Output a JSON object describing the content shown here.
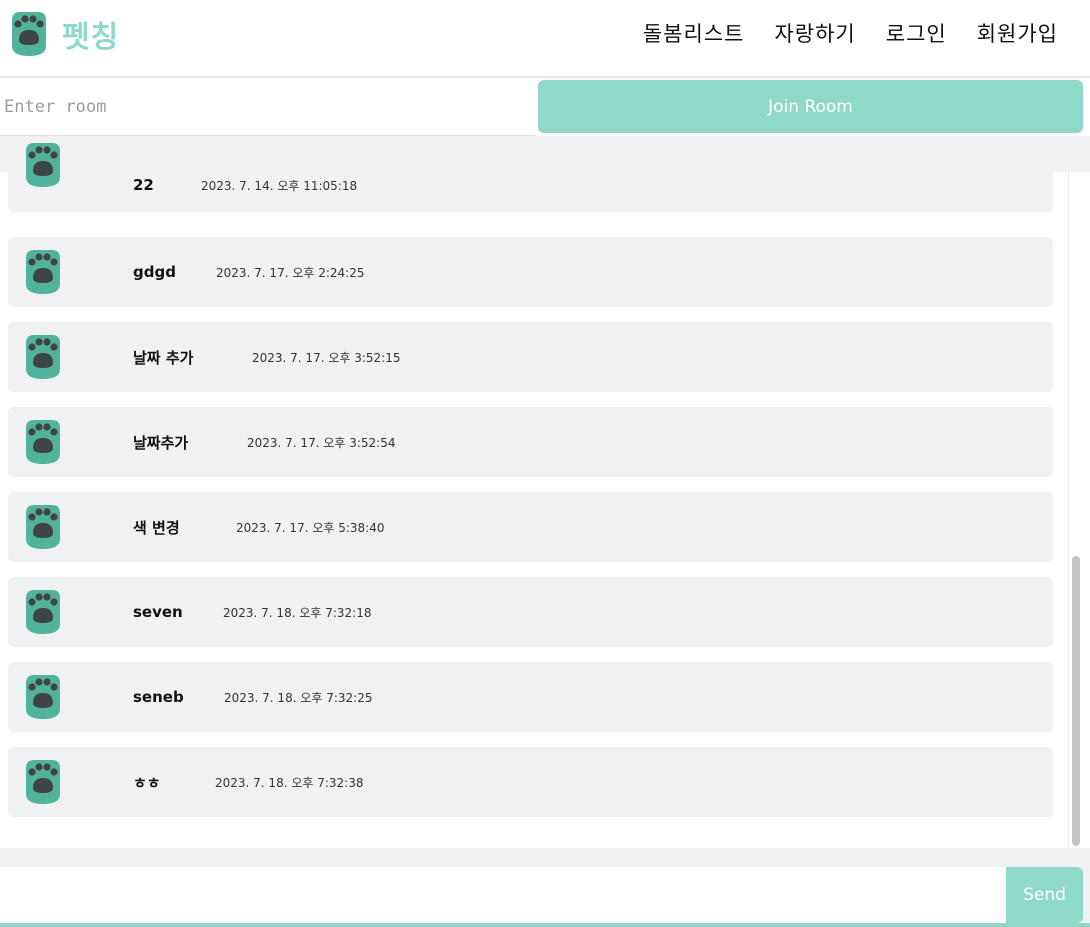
{
  "header": {
    "logo_text": "펫칭",
    "nav": [
      {
        "label": "돌봄리스트"
      },
      {
        "label": "자랑하기"
      },
      {
        "label": "로그인"
      },
      {
        "label": "회원가입"
      }
    ]
  },
  "room": {
    "placeholder": "Enter room",
    "join_label": "Join Room"
  },
  "messages": [
    {
      "name": "22",
      "time": "2023. 7. 14. 오후 11:05:18"
    },
    {
      "name": "gdgd",
      "time": "2023. 7. 17. 오후 2:24:25"
    },
    {
      "name": "날짜 추가",
      "time": "2023. 7. 17. 오후 3:52:15"
    },
    {
      "name": "날짜추가",
      "time": "2023. 7. 17. 오후 3:52:54"
    },
    {
      "name": "색 변경",
      "time": "2023. 7. 17. 오후 5:38:40"
    },
    {
      "name": "seven",
      "time": "2023. 7. 18. 오후 7:32:18"
    },
    {
      "name": "seneb",
      "time": "2023. 7. 18. 오후 7:32:25"
    },
    {
      "name": "ㅎㅎ",
      "time": "2023. 7. 18. 오후 7:32:38"
    }
  ],
  "composer": {
    "placeholder": "",
    "send_label": "Send"
  },
  "colors": {
    "accent": "#8ed9c8",
    "paw_body": "#52b39b",
    "paw_pad": "#3f4447",
    "row_bg": "#f0f1f3"
  },
  "icons": {
    "logo": "paw-icon",
    "avatar": "paw-icon"
  }
}
